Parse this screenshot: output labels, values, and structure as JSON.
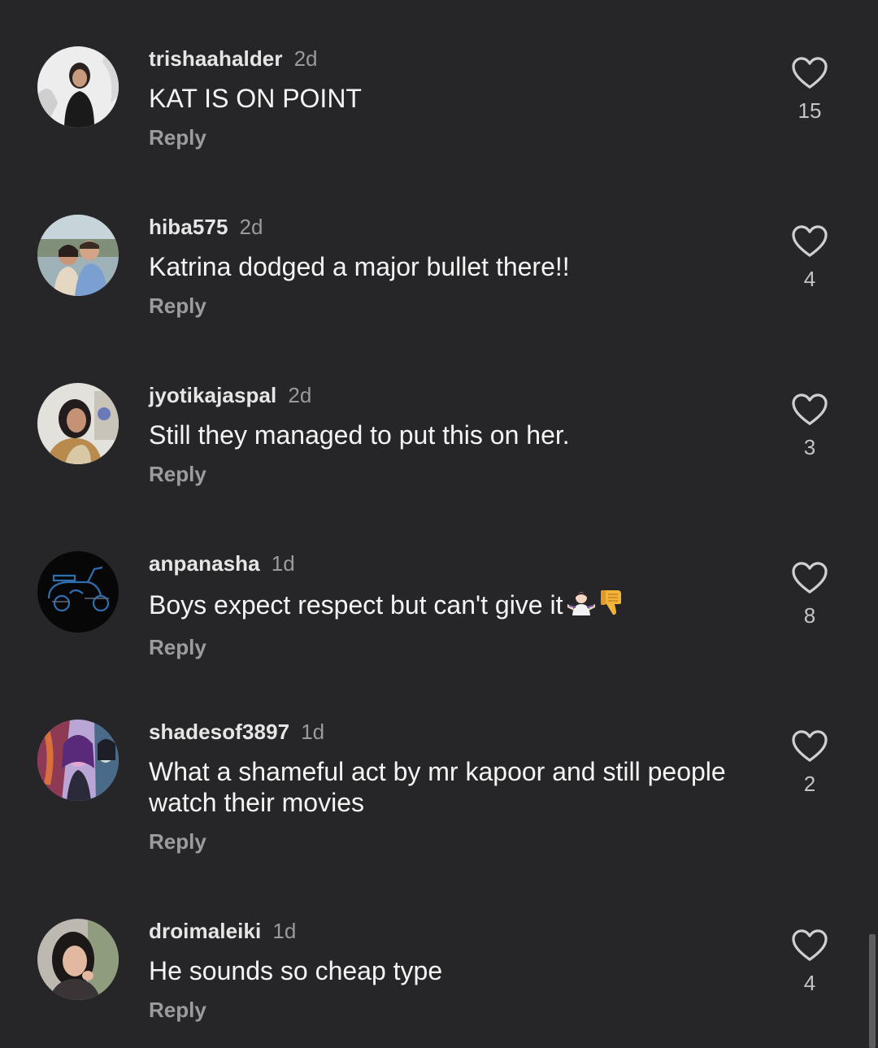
{
  "comments": [
    {
      "username": "trishaahalder",
      "time": "2d",
      "text": "KAT IS ON POINT",
      "reply": "Reply",
      "likes": "15",
      "avatar_icon": "avatar-portrait-icon",
      "avatar_colors": [
        "#f0f0f0",
        "#1c1c1c"
      ]
    },
    {
      "username": "hiba575",
      "time": "2d",
      "text": "Katrina dodged a major bullet there!!",
      "reply": "Reply",
      "likes": "4",
      "avatar_icon": "avatar-couple-photo-icon",
      "avatar_colors": [
        "#8aa0a8",
        "#d8c0a4"
      ]
    },
    {
      "username": "jyotikajaspal",
      "time": "2d",
      "text": "Still they managed to put this on her.",
      "reply": "Reply",
      "likes": "3",
      "avatar_icon": "avatar-portrait-icon",
      "avatar_colors": [
        "#d8d6d0",
        "#2a2224"
      ]
    },
    {
      "username": "anpanasha",
      "time": "1d",
      "text": "Boys expect respect but can't give it",
      "reply": "Reply",
      "likes": "8",
      "avatar_icon": "avatar-scooter-icon",
      "avatar_colors": [
        "#080808",
        "#2f6fb0"
      ]
    },
    {
      "username": "shadesof3897",
      "time": "1d",
      "text": "What a shameful act by mr kapoor and still people watch their movies",
      "reply": "Reply",
      "likes": "2",
      "avatar_icon": "avatar-cartoon-icon",
      "avatar_colors": [
        "#7a3a8a",
        "#d05a9a"
      ]
    },
    {
      "username": "droimaleiki",
      "time": "1d",
      "text": "He sounds so cheap type",
      "reply": "Reply",
      "likes": "4",
      "avatar_icon": "avatar-portrait-icon",
      "avatar_colors": [
        "#b8b4ae",
        "#1e1a1a"
      ]
    }
  ],
  "emojis": [
    "person-shrugging-emoji",
    "thumbs-down-emoji"
  ],
  "colors": {
    "background": "#262628",
    "username": "#e6e6e6",
    "text": "#f4f4f4",
    "secondary": "#9a9a9c"
  }
}
